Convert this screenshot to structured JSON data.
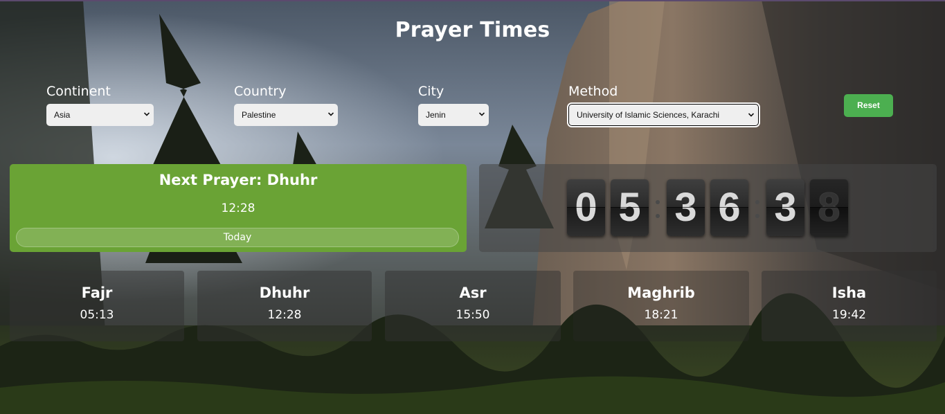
{
  "header": {
    "title": "Prayer Times"
  },
  "filters": {
    "continent": {
      "label": "Continent",
      "value": "Asia"
    },
    "country": {
      "label": "Country",
      "value": "Palestine"
    },
    "city": {
      "label": "City",
      "value": "Jenin"
    },
    "method": {
      "label": "Method",
      "value": "University of Islamic Sciences, Karachi"
    },
    "reset_label": "Reset"
  },
  "next_prayer": {
    "title": "Next Prayer: Dhuhr",
    "time": "12:28",
    "day": "Today"
  },
  "countdown": {
    "digits": [
      "0",
      "5",
      "3",
      "6",
      "3",
      "8"
    ]
  },
  "prayers": [
    {
      "name": "Fajr",
      "time": "05:13"
    },
    {
      "name": "Dhuhr",
      "time": "12:28"
    },
    {
      "name": "Asr",
      "time": "15:50"
    },
    {
      "name": "Maghrib",
      "time": "18:21"
    },
    {
      "name": "Isha",
      "time": "19:42"
    }
  ]
}
